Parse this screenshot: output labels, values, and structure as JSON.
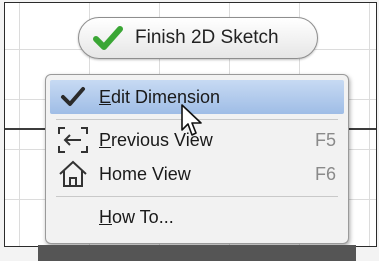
{
  "toolbar": {
    "finish_label": "Finish 2D Sketch",
    "finish_icon": "checkmark-icon",
    "accent": "#3aa635"
  },
  "context_menu": {
    "items": [
      {
        "prefix": "",
        "ul": "E",
        "rest": "dit Dimension",
        "shortcut": "",
        "icon": "checkmark-icon",
        "highlighted": true
      },
      {
        "prefix": "",
        "ul": "P",
        "rest": "revious View",
        "shortcut": "F5",
        "icon": "previous-view-icon",
        "highlighted": false
      },
      {
        "prefix": "Home View",
        "ul": "",
        "rest": "",
        "shortcut": "F6",
        "icon": "home-icon",
        "highlighted": false
      },
      {
        "prefix": "",
        "ul": "H",
        "rest": "ow To...",
        "shortcut": "",
        "icon": "",
        "highlighted": false
      }
    ],
    "highlight_color": "#aec8ec"
  }
}
